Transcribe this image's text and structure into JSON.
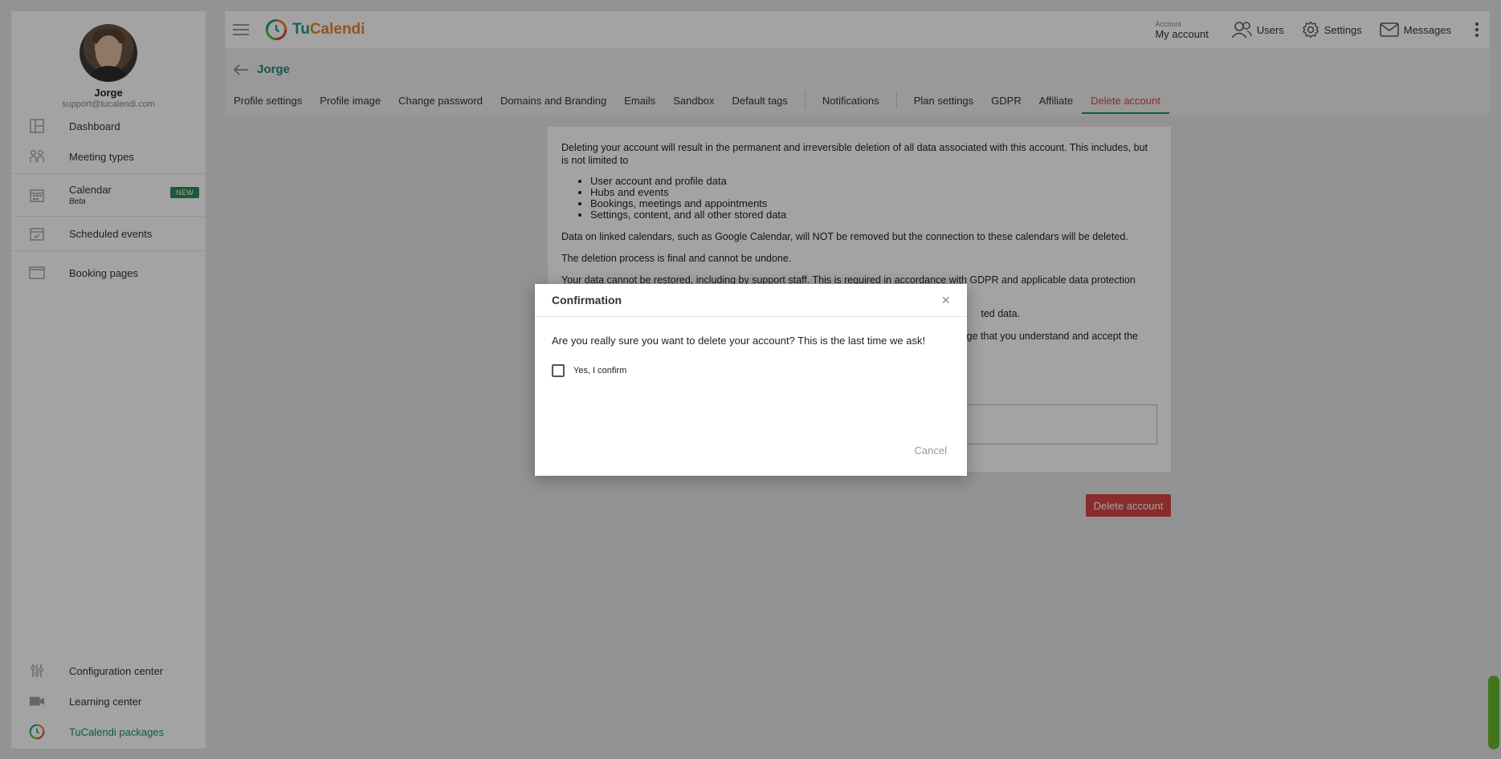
{
  "profile": {
    "name": "Jorge",
    "email": "support@tucalendi.com"
  },
  "sidebar": {
    "items": [
      {
        "label": "Dashboard",
        "icon": "dashboard-icon"
      },
      {
        "label": "Meeting types",
        "icon": "people-icon"
      },
      {
        "label": "Calendar",
        "sub": "Beta",
        "badge": "NEW",
        "icon": "calendar-icon"
      },
      {
        "label": "Scheduled events",
        "icon": "calendar-check-icon"
      },
      {
        "label": "Booking pages",
        "icon": "browser-window-icon"
      }
    ],
    "bottom": [
      {
        "label": "Configuration center",
        "icon": "sliders-icon"
      },
      {
        "label": "Learning center",
        "icon": "video-icon"
      },
      {
        "label": "TuCalendi packages",
        "icon": "tucalendi-logo-icon"
      }
    ]
  },
  "topbar": {
    "logo_part1": "Tu",
    "logo_part2": "Calendi",
    "account_small": "Account",
    "account_big": "My account",
    "users": "Users",
    "settings": "Settings",
    "messages": "Messages"
  },
  "header": {
    "breadcrumb": "Jorge",
    "tabs_group1": [
      "Profile settings",
      "Profile image",
      "Change password",
      "Domains and Branding",
      "Emails",
      "Sandbox",
      "Default tags"
    ],
    "tabs_group2": [
      "Notifications"
    ],
    "tabs_group3": [
      "Plan settings",
      "GDPR",
      "Affiliate",
      "Delete account"
    ],
    "active_tab": "Delete account"
  },
  "content": {
    "intro": "Deleting your account will result in the permanent and irreversible deletion of all data associated with this account. This includes, but is not limited to",
    "list": [
      "User account and profile data",
      "Hubs and events",
      "Bookings, meetings and appointments",
      "Settings, content, and all other stored data"
    ],
    "p2": "Data on linked calendars, such as Google Calendar, will NOT be removed but the connection to these calendars will be deleted.",
    "p3": "The deletion process is final and cannot be undone.",
    "p4": "Your data cannot be restored, including by support staff. This is required in accordance with GDPR and applicable data protection",
    "p5_tail": "ted data.",
    "p6_tail": "lge that you understand and accept the",
    "delete_button": "Delete account"
  },
  "modal": {
    "title": "Confirmation",
    "close": "×",
    "question": "Are you really sure you want to delete your account? This is the last time we ask!",
    "checkbox_label": "Yes, I confirm",
    "checkbox_checked": false,
    "cancel": "Cancel"
  },
  "colors": {
    "teal": "#1a8a7e",
    "orange": "#e8852b",
    "danger": "#d64545",
    "badge": "#2e8b57",
    "scroll": "#6ab82e"
  }
}
